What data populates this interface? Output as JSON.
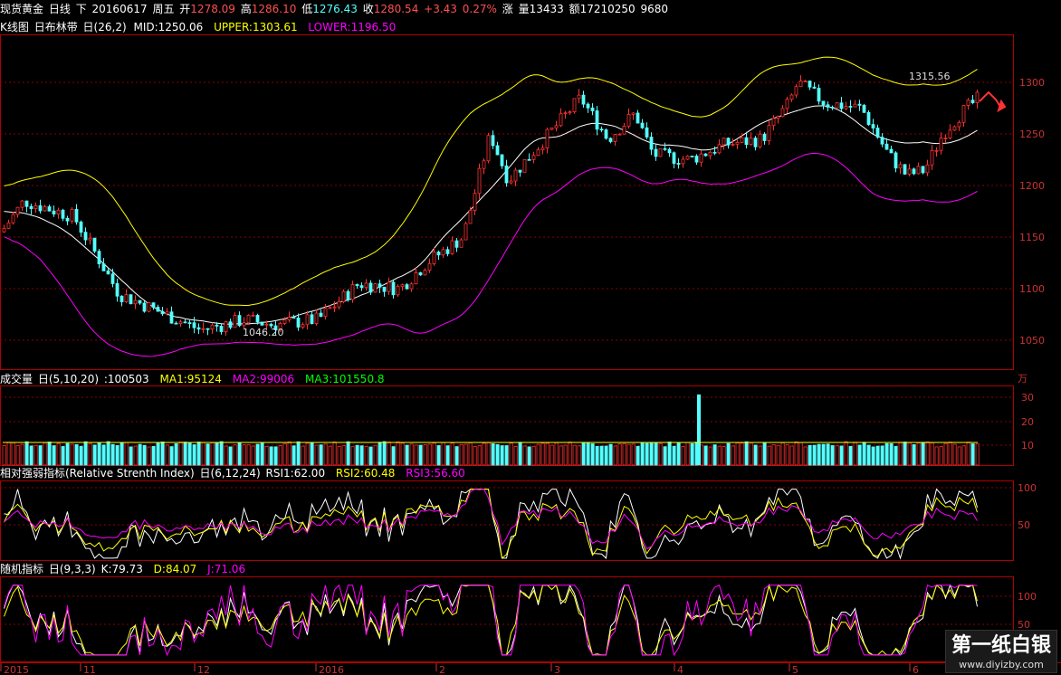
{
  "info_bar": {
    "instrument": "现货黄金",
    "period": "日线",
    "direction": "下",
    "date": "20160617",
    "weekday": "周五",
    "open_label": "开",
    "open": "1278.09",
    "high_label": "高",
    "high": "1286.10",
    "low_label": "低",
    "low": "1276.43",
    "close_label": "收",
    "close": "1280.54",
    "change_label": "涨",
    "change": "+3.43",
    "change_pct": "0.27%",
    "volume_label": "量",
    "volume": "13433",
    "amount_label": "额",
    "amount": "17210250",
    "extra": "9680"
  },
  "kline_panel": {
    "title": "K线图",
    "indicator": "日布林带",
    "params": "日(26,2)",
    "mid": "MID:1250.06",
    "upper": "UPPER:1303.61",
    "lower": "LOWER:1196.50",
    "y_ticks": [
      "1300",
      "1250",
      "1200",
      "1150",
      "1100",
      "1050"
    ],
    "annot_high": "1315.56",
    "annot_low": "1046.20"
  },
  "volume_panel": {
    "title": "成交量",
    "params": "日(5,10,20)",
    "value": ":100503",
    "ma1": "MA1:95124",
    "ma2": "MA2:99006",
    "ma3": "MA3:101550.8",
    "unit": "万",
    "y_ticks": [
      "30",
      "20",
      "10"
    ]
  },
  "rsi_panel": {
    "title": "相对强弱指标(Relative Strenth Index)",
    "params": "日(6,12,24)",
    "rsi1": "RSI1:62.00",
    "rsi2": "RSI2:60.48",
    "rsi3": "RSI3:56.60",
    "y_ticks": [
      "100",
      "50"
    ]
  },
  "kdj_panel": {
    "title": "随机指标",
    "params": "日(9,3,3)",
    "k": "K:79.73",
    "d": "D:84.07",
    "j": "J:71.06",
    "y_ticks": [
      "100",
      "50"
    ]
  },
  "x_axis": {
    "labels": [
      "2015",
      "11",
      "12",
      "2016",
      "2",
      "3",
      "4",
      "5",
      "6"
    ]
  },
  "watermark": {
    "text": "第一纸白银",
    "url": "www.diyizby.com"
  },
  "colors": {
    "up": "#ff3232",
    "down": "#54ffff",
    "grid": "#8b0000",
    "mid_line": "#ffffff",
    "upper_line": "#ffff00",
    "lower_line": "#ff00ff",
    "rsi1": "#ffffff",
    "rsi2": "#ffff00",
    "rsi3": "#ff00ff",
    "volume_up": "#ff3232",
    "volume_down": "#54ffff"
  }
}
